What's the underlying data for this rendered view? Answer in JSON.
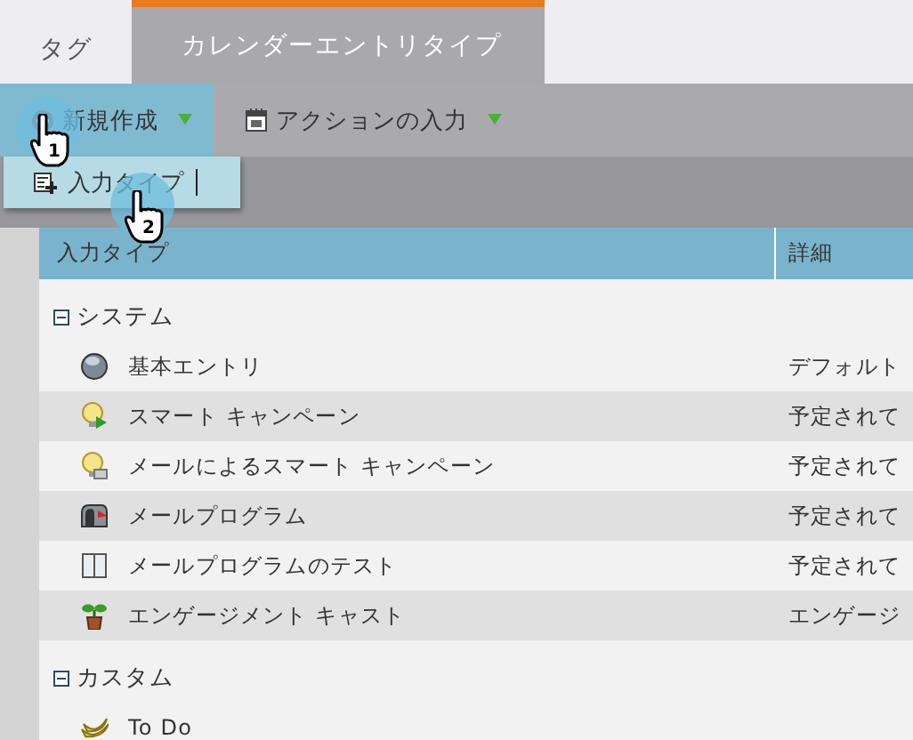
{
  "tabs": [
    {
      "label": "タグ",
      "selected": false
    },
    {
      "label": "カレンダーエントリタイプ",
      "selected": true
    }
  ],
  "toolbar": [
    {
      "label": "新規作成",
      "kind": "new",
      "highlighted": true
    },
    {
      "label": "アクションの入力",
      "kind": "action",
      "highlighted": false
    }
  ],
  "menu": {
    "items": [
      {
        "label": "入力タイプ"
      }
    ]
  },
  "table": {
    "columns": [
      "入力タイプ",
      "詳細"
    ],
    "groups": [
      {
        "label": "システム",
        "expanded": true,
        "rows": [
          {
            "name": "基本エントリ",
            "detail": "デフォルト"
          },
          {
            "name": "スマート キャンペーン",
            "detail": "予定されて"
          },
          {
            "name": "メールによるスマート キャンペーン",
            "detail": "予定されて"
          },
          {
            "name": "メールプログラム",
            "detail": "予定されて"
          },
          {
            "name": "メールプログラムのテスト",
            "detail": "予定されて"
          },
          {
            "name": "エンゲージメント キャスト",
            "detail": "エンゲージ"
          }
        ]
      },
      {
        "label": "カスタム",
        "expanded": true,
        "rows": [
          {
            "name": "To Do"
          }
        ]
      }
    ]
  },
  "callouts": [
    {
      "number": "1"
    },
    {
      "number": "2"
    }
  ]
}
